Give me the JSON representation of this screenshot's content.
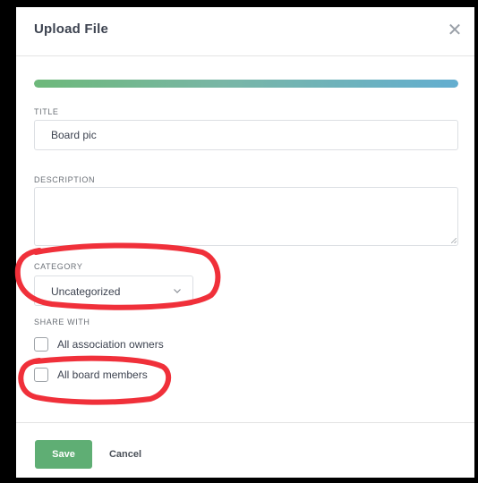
{
  "dialog": {
    "title": "Upload File",
    "close_glyph": "✕",
    "close_icon": "close-icon"
  },
  "progress": {
    "percent": 100,
    "colors": [
      "#6db87a",
      "#63aed0"
    ]
  },
  "form": {
    "title_label": "TITLE",
    "title_value": "Board pic",
    "description_label": "DESCRIPTION",
    "description_value": "",
    "category_label": "CATEGORY",
    "category_value": "Uncategorized",
    "category_icon": "chevron-down-icon",
    "share_label": "SHARE WITH",
    "share_options": [
      {
        "label": "All association owners",
        "checked": false
      },
      {
        "label": "All board members",
        "checked": false
      }
    ]
  },
  "footer": {
    "save_label": "Save",
    "cancel_label": "Cancel"
  },
  "colors": {
    "save_button": "#5fae74",
    "annotation": "#f0303a"
  }
}
